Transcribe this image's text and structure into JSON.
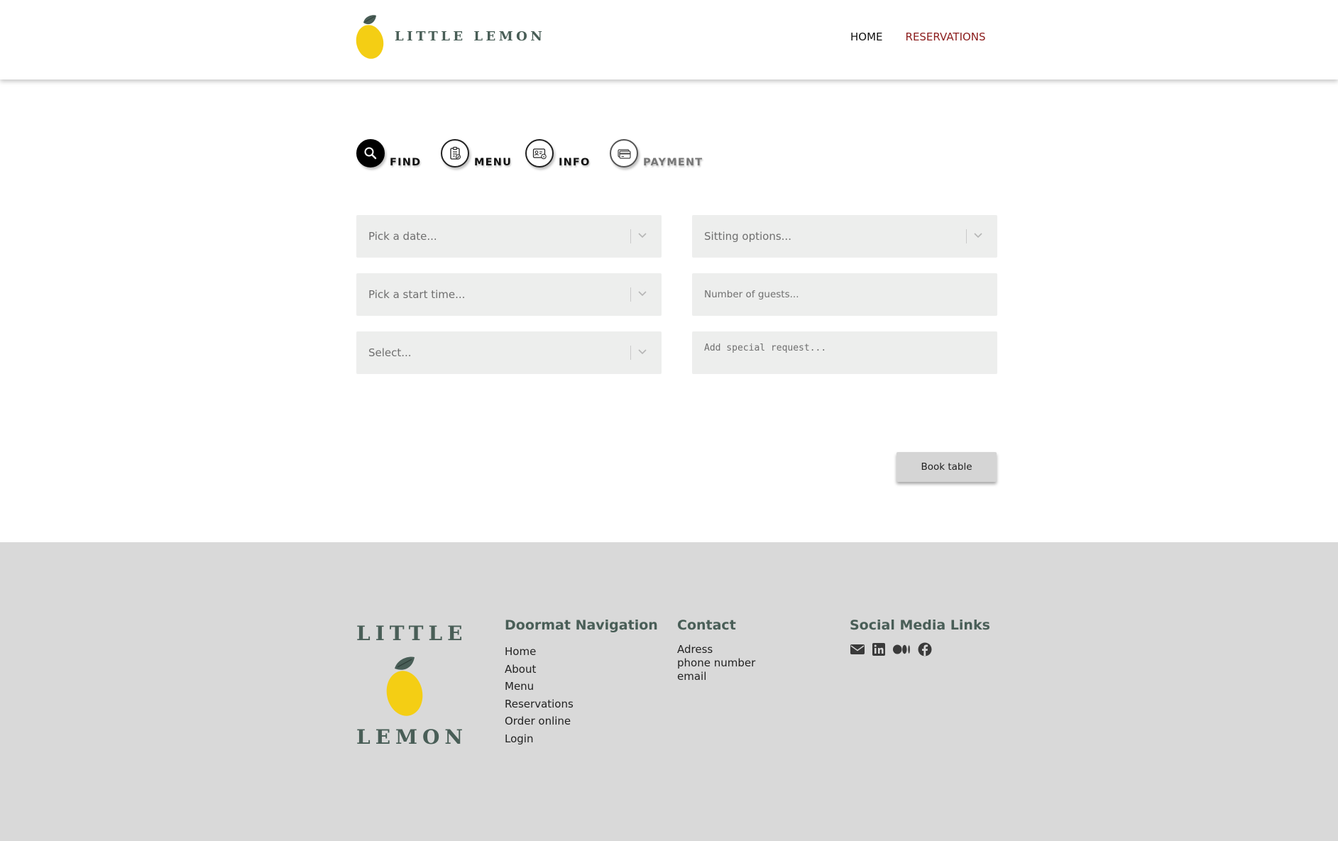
{
  "brand": {
    "name": "LITTLE LEMON",
    "footer_word1": "LITTLE",
    "footer_word2": "LEMON"
  },
  "nav": {
    "home": "HOME",
    "reservations": "RESERVATIONS"
  },
  "steps": [
    {
      "label": "FIND",
      "icon": "search-icon",
      "state": "active"
    },
    {
      "label": "MENU",
      "icon": "clipboard-icon",
      "state": "done"
    },
    {
      "label": "INFO",
      "icon": "id-card-icon",
      "state": "done"
    },
    {
      "label": "PAYMENT",
      "icon": "credit-card-icon",
      "state": "pending"
    }
  ],
  "form": {
    "date_placeholder": "Pick a date...",
    "time_placeholder": "Pick a start time...",
    "select_placeholder": "Select...",
    "sitting_placeholder": "Sitting options...",
    "guests_placeholder": "Number of guests...",
    "request_placeholder": "Add special request...",
    "book_label": "Book table"
  },
  "footer": {
    "nav_title": "Doormat Navigation",
    "nav_items": [
      "Home",
      "About",
      "Menu",
      "Reservations",
      "Order online",
      "Login"
    ],
    "contact_title": "Contact",
    "contact_items": [
      "Adress",
      "phone number",
      "email"
    ],
    "social_title": "Social Media Links",
    "social_icons": [
      "envelope-icon",
      "linkedin-icon",
      "medium-icon",
      "facebook-icon"
    ]
  },
  "colors": {
    "brand_green": "#495e57",
    "lemon_yellow": "#f4ce14",
    "active_nav": "#8b1c1c",
    "field_bg": "#edeeed",
    "footer_bg": "#d9d9d9"
  }
}
